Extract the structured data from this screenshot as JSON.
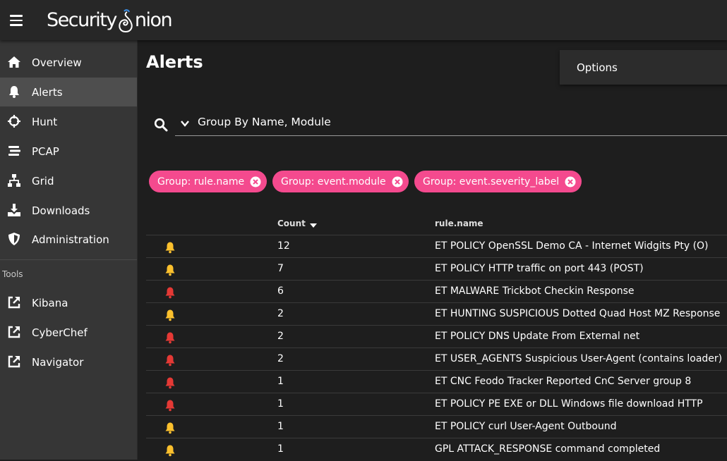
{
  "app": {
    "logo_text_left": "Security",
    "logo_text_right": "nion"
  },
  "sidebar": {
    "items": [
      {
        "label": "Overview",
        "icon": "home-icon"
      },
      {
        "label": "Alerts",
        "icon": "bell-icon",
        "active": true
      },
      {
        "label": "Hunt",
        "icon": "crosshairs-icon"
      },
      {
        "label": "PCAP",
        "icon": "stream-icon"
      },
      {
        "label": "Grid",
        "icon": "sitemap-icon"
      },
      {
        "label": "Downloads",
        "icon": "download-icon"
      },
      {
        "label": "Administration",
        "icon": "shield-icon"
      }
    ],
    "tools_label": "Tools",
    "tools": [
      {
        "label": "Kibana",
        "icon": "external-link-icon"
      },
      {
        "label": "CyberChef",
        "icon": "external-link-icon"
      },
      {
        "label": "Navigator",
        "icon": "external-link-icon"
      }
    ]
  },
  "main": {
    "title": "Alerts",
    "options_label": "Options",
    "query": "Group By Name, Module",
    "chips": [
      {
        "label": "Group: rule.name"
      },
      {
        "label": "Group: event.module"
      },
      {
        "label": "Group: event.severity_label"
      }
    ],
    "table": {
      "headers": {
        "count": "Count",
        "rule": "rule.name"
      },
      "rows": [
        {
          "severity": "medium",
          "count": "12",
          "rule": "ET POLICY OpenSSL Demo CA - Internet Widgits Pty (O)"
        },
        {
          "severity": "medium",
          "count": "7",
          "rule": "ET POLICY HTTP traffic on port 443 (POST)"
        },
        {
          "severity": "high",
          "count": "6",
          "rule": "ET MALWARE Trickbot Checkin Response"
        },
        {
          "severity": "medium",
          "count": "2",
          "rule": "ET HUNTING SUSPICIOUS Dotted Quad Host MZ Response"
        },
        {
          "severity": "high",
          "count": "2",
          "rule": "ET POLICY DNS Update From External net"
        },
        {
          "severity": "high",
          "count": "2",
          "rule": "ET USER_AGENTS Suspicious User-Agent (contains loader)"
        },
        {
          "severity": "high",
          "count": "1",
          "rule": "ET CNC Feodo Tracker Reported CnC Server group 8"
        },
        {
          "severity": "high",
          "count": "1",
          "rule": "ET POLICY PE EXE or DLL Windows file download HTTP"
        },
        {
          "severity": "medium",
          "count": "1",
          "rule": "ET POLICY curl User-Agent Outbound"
        },
        {
          "severity": "medium",
          "count": "1",
          "rule": "GPL ATTACK_RESPONSE command completed"
        }
      ]
    }
  },
  "colors": {
    "accent": "#f44a8e",
    "severity_high": "#e53935",
    "severity_medium": "#fbc02d"
  }
}
